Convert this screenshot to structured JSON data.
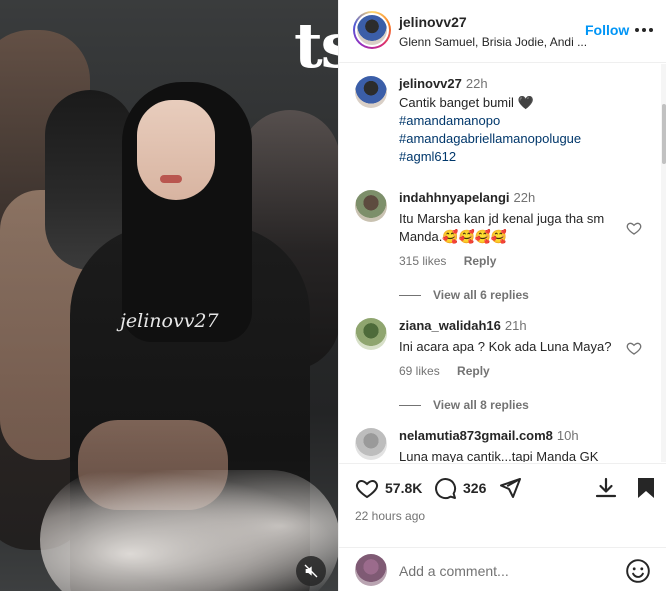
{
  "media": {
    "logo_text": "ts",
    "watermark": "jelinovv27",
    "mute_icon": "speaker-muted-icon"
  },
  "header": {
    "username": "jelinovv27",
    "subtitle": "Glenn Samuel, Brisia Jodie, Andi ...",
    "follow_label": "Follow",
    "more_icon": "more-horizontal-icon"
  },
  "caption": {
    "username": "jelinovv27",
    "time": "22h",
    "text": "Cantik banget bumil 🖤",
    "hashtags": [
      "#amandamanopo",
      "#amandagabriellamanopolugue",
      "#agml612"
    ]
  },
  "comments": [
    {
      "username": "indahhnyapelangi",
      "time": "22h",
      "text": "Itu Marsha kan jd kenal juga tha sm Manda.🥰🥰🥰🥰",
      "likes": "315 likes",
      "reply_label": "Reply",
      "view_replies": "View all 6 replies"
    },
    {
      "username": "ziana_walidah16",
      "time": "21h",
      "text": "Ini acara apa ? Kok ada Luna Maya?",
      "likes": "69 likes",
      "reply_label": "Reply",
      "view_replies": "View all 8 replies"
    },
    {
      "username": "nelamutia873gmail.com8",
      "time": "10h",
      "text": "Luna maya cantik...tapi Manda GK"
    }
  ],
  "actions": {
    "like_count": "57.8K",
    "comment_count": "326",
    "posted": "22 hours ago"
  },
  "add_comment": {
    "placeholder": "Add a comment..."
  },
  "colors": {
    "link_blue": "#0095f6",
    "hashtag_blue": "#00376b",
    "muted_text": "#737373",
    "text": "#262626"
  }
}
